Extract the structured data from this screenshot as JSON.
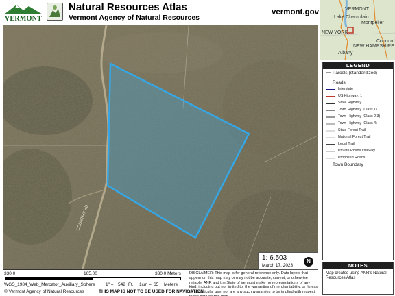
{
  "header": {
    "logo_text": "VERMONT",
    "title": "Natural Resources Atlas",
    "subtitle": "Vermont Agency of Natural Resources",
    "site": "vermont.gov"
  },
  "locator": {
    "labels": [
      "VERMONT",
      "Lake Champlain",
      "Montpelier",
      "Concord",
      "NEW YORK",
      "NEW HAMPSHIRE",
      "Albany"
    ]
  },
  "legend": {
    "title": "LEGEND",
    "items": [
      {
        "label": "Parcels (standardized)",
        "symbol": "box-empty"
      },
      {
        "label": "Roads",
        "symbol": "none"
      },
      {
        "label": "Interstate",
        "symbol": "line",
        "color": "#1a1a8a"
      },
      {
        "label": "US Highway; 1",
        "symbol": "line",
        "color": "#c0392b"
      },
      {
        "label": "State Highway",
        "symbol": "line",
        "color": "#333333"
      },
      {
        "label": "Town Highway (Class 1)",
        "symbol": "line",
        "color": "#888888"
      },
      {
        "label": "Town Highway (Class 2,3)",
        "symbol": "line",
        "color": "#999999"
      },
      {
        "label": "Town Highway (Class 4)",
        "symbol": "line",
        "color": "#bbbbbb"
      },
      {
        "label": "State Forest Trail",
        "symbol": "line",
        "color": "#dddddd"
      },
      {
        "label": "National Forest Trail",
        "symbol": "line",
        "color": "#dddddd"
      },
      {
        "label": "Legal Trail",
        "symbol": "line",
        "color": "#444444"
      },
      {
        "label": "Private Road/Driveway",
        "symbol": "line",
        "color": "#cccccc"
      },
      {
        "label": "Proposed Roads",
        "symbol": "line",
        "color": "#dddddd"
      },
      {
        "label": "Town Boundary",
        "symbol": "box-gold"
      }
    ]
  },
  "notes": {
    "title": "NOTES",
    "text": "Map created using ANR's Natural Resources Atlas"
  },
  "map": {
    "scale_ratio": "1: 6,503",
    "date": "March 17, 2023",
    "north_symbol": "N",
    "parcel_color": "#35a7e6",
    "road_label": "COUNTRY RD"
  },
  "scalebar": {
    "left_num": "330.0",
    "mid_num": "165.00",
    "right_num": "330.0 Meters",
    "proj": "WGS_1984_Web_Mercator_Auxiliary_Sphere",
    "inch": "1\" =",
    "ft": "542",
    "ft_unit": "Ft.",
    "cm": "1cm =",
    "m": "65",
    "m_unit": "Meters",
    "copyright": "© Vermont Agency of Natural Resources",
    "warning": "THIS MAP IS NOT TO BE USED FOR NAVIGATION"
  },
  "disclaimer": "DISCLAIMER: This map is for general reference only. Data layers that appear on this map may or may not be accurate, current, or otherwise reliable. ANR and the State of Vermont make no representations of any kind, including but not limited to, the warranties of merchantability, or fitness for a particular use, nor are any such warranties to be implied with respect to the data on this map."
}
